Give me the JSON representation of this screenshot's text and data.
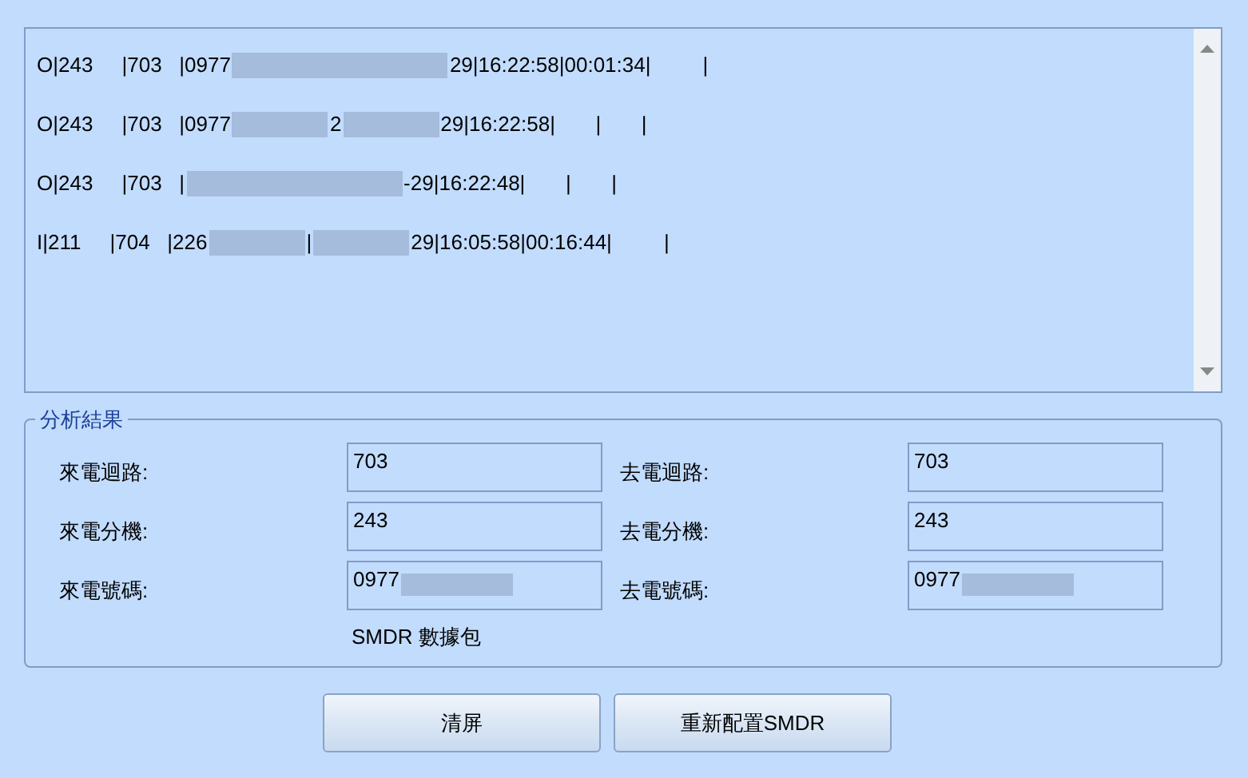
{
  "log": {
    "lines": [
      [
        {
          "kind": "text",
          "text": "O|243     |703   |0977"
        },
        {
          "kind": "redacted",
          "wide": true
        },
        {
          "kind": "text",
          "text": "29|16:22:58|00:01:34|         |"
        }
      ],
      [
        {
          "kind": "text",
          "text": "O|243     |703   |0977"
        },
        {
          "kind": "redacted",
          "wide": false
        },
        {
          "kind": "text",
          "text": "2"
        },
        {
          "kind": "redacted",
          "wide": false
        },
        {
          "kind": "text",
          "text": "29|16:22:58|       |       |"
        }
      ],
      [
        {
          "kind": "text",
          "text": "O|243     |703   |"
        },
        {
          "kind": "redacted",
          "wide": true
        },
        {
          "kind": "text",
          "text": "-29|16:22:48|       |       |"
        }
      ],
      [
        {
          "kind": "text",
          "text": "I|211     |704   |226"
        },
        {
          "kind": "redacted",
          "wide": false
        },
        {
          "kind": "text",
          "text": "|"
        },
        {
          "kind": "redacted",
          "wide": false
        },
        {
          "kind": "text",
          "text": "29|16:05:58|00:16:44|         |"
        }
      ]
    ]
  },
  "analysis": {
    "title": "分析結果",
    "fields": [
      {
        "label": "來電迴路:",
        "value": "703",
        "redacted": false
      },
      {
        "label": "去電迴路:",
        "value": "703",
        "redacted": false
      },
      {
        "label": "來電分機:",
        "value": "243",
        "redacted": false
      },
      {
        "label": "去電分機:",
        "value": "243",
        "redacted": false
      },
      {
        "label": "來電號碼:",
        "value": "0977",
        "redacted": true
      },
      {
        "label": "去電號碼:",
        "value": "0977",
        "redacted": true
      }
    ],
    "caption": "SMDR 數據包"
  },
  "buttons": [
    "清屏",
    "重新配置SMDR"
  ]
}
